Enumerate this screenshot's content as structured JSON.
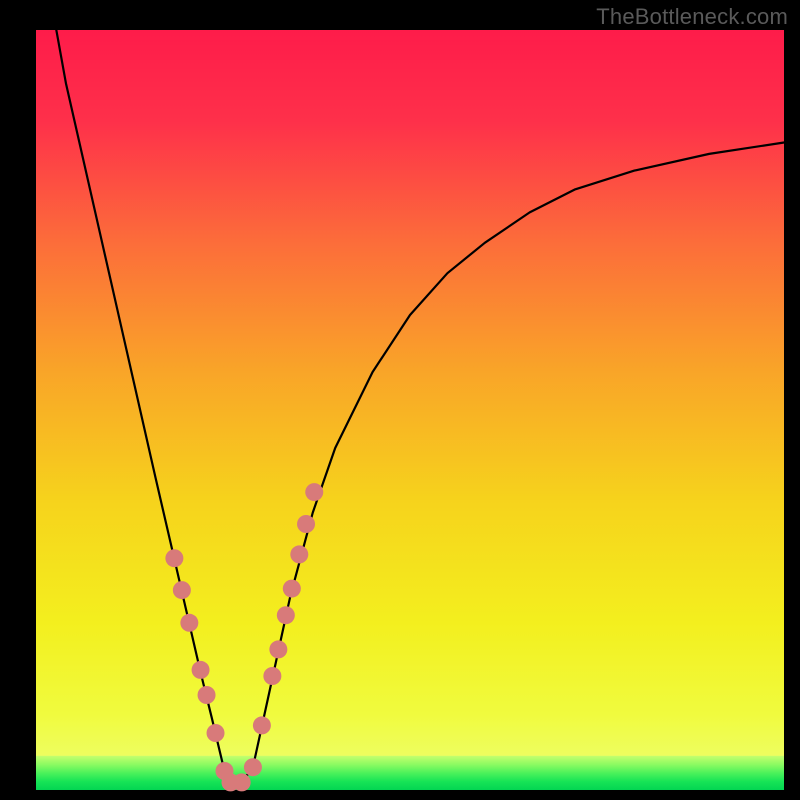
{
  "watermark": "TheBottleneck.com",
  "colors": {
    "frame": "#000000",
    "dot_fill": "#d87a7a",
    "dot_stroke": "#b85a5a",
    "curve_stroke": "#000000",
    "watermark": "#5a5a5a"
  },
  "plot": {
    "inner_x": 36,
    "inner_y": 30,
    "inner_w": 748,
    "inner_h": 760,
    "green_band_top": 0.955,
    "green_band_bottom": 1.0
  },
  "chart_data": {
    "type": "line",
    "title": "",
    "xlabel": "",
    "ylabel": "",
    "xlim": [
      0,
      1
    ],
    "ylim": [
      0,
      1
    ],
    "series": [
      {
        "name": "curve",
        "x": [
          0.018,
          0.04,
          0.07,
          0.1,
          0.13,
          0.16,
          0.18,
          0.2,
          0.22,
          0.235,
          0.25,
          0.26,
          0.275,
          0.29,
          0.3,
          0.32,
          0.34,
          0.37,
          0.4,
          0.45,
          0.5,
          0.55,
          0.6,
          0.66,
          0.72,
          0.8,
          0.9,
          1.0
        ],
        "y": [
          1.05,
          0.93,
          0.8,
          0.67,
          0.54,
          0.41,
          0.325,
          0.24,
          0.155,
          0.095,
          0.033,
          0.01,
          0.01,
          0.03,
          0.075,
          0.165,
          0.255,
          0.365,
          0.45,
          0.55,
          0.625,
          0.68,
          0.72,
          0.76,
          0.79,
          0.815,
          0.837,
          0.852
        ]
      }
    ],
    "dots": {
      "name": "highlighted-points",
      "x": [
        0.185,
        0.195,
        0.205,
        0.22,
        0.228,
        0.24,
        0.252,
        0.26,
        0.275,
        0.29,
        0.302,
        0.316,
        0.324,
        0.334,
        0.342,
        0.352,
        0.361,
        0.372
      ],
      "y": [
        0.305,
        0.263,
        0.22,
        0.158,
        0.125,
        0.075,
        0.025,
        0.01,
        0.01,
        0.03,
        0.085,
        0.15,
        0.185,
        0.23,
        0.265,
        0.31,
        0.35,
        0.392
      ]
    }
  }
}
